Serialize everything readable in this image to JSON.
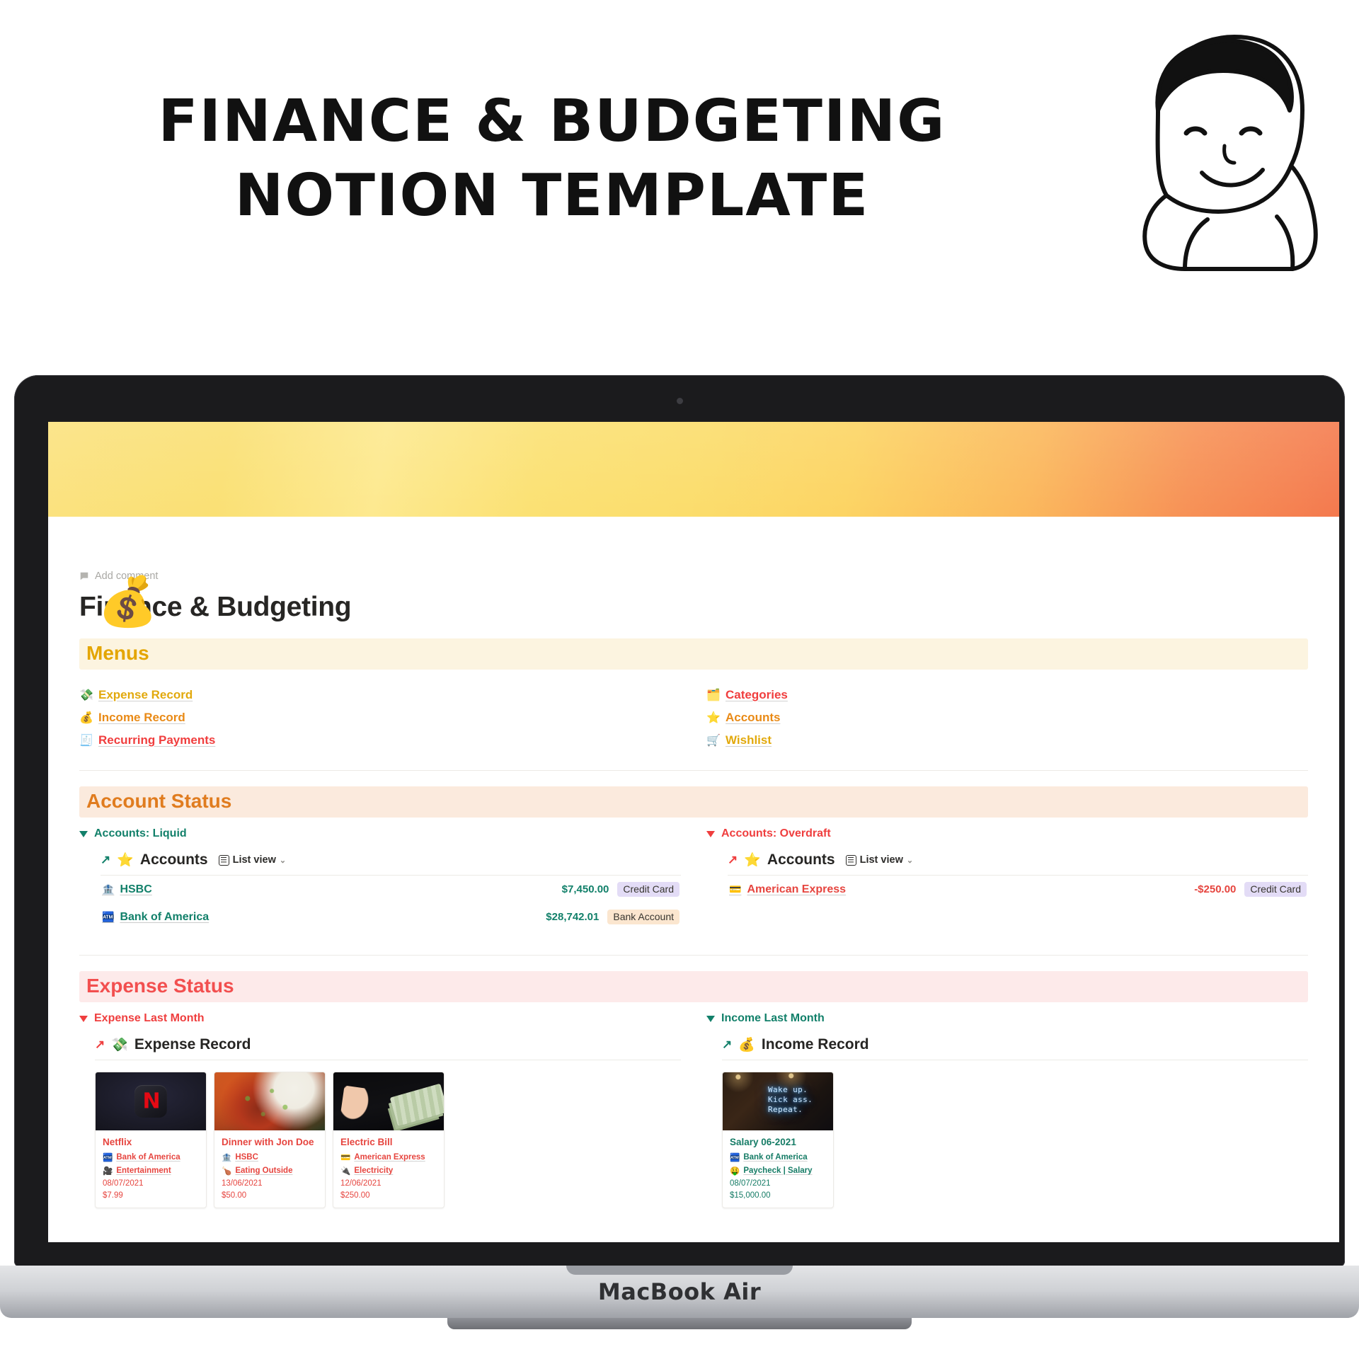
{
  "promo": {
    "title_line1": "Finance & Budgeting",
    "title_line2": "Notion Template"
  },
  "laptop": {
    "model_label": "MacBook Air"
  },
  "notion": {
    "page_emoji": "💰",
    "add_comment": "Add comment",
    "page_title": "Finance & Budgeting",
    "sections": {
      "menus": {
        "heading": "Menus",
        "left_items": [
          {
            "emoji": "💸",
            "label": "Expense Record",
            "color": "c-gold"
          },
          {
            "emoji": "💰",
            "label": "Income Record",
            "color": "c-orange"
          },
          {
            "emoji": "🧾",
            "label": "Recurring Payments",
            "color": "c-red"
          }
        ],
        "right_items": [
          {
            "emoji": "🗂️",
            "label": "Categories",
            "color": "c-red"
          },
          {
            "emoji": "⭐",
            "label": "Accounts",
            "color": "c-orange"
          },
          {
            "emoji": "🛒",
            "label": "Wishlist",
            "color": "c-gold"
          }
        ]
      },
      "account_status": {
        "heading": "Account Status",
        "liquid": {
          "toggle_label": "Accounts: Liquid",
          "db_emoji": "⭐",
          "db_name": "Accounts",
          "view_label": "List view",
          "rows": [
            {
              "emoji": "🏦",
              "name": "HSBC",
              "value": "$7,450.00",
              "tag": "Credit Card",
              "tag_class": "tag-credit"
            },
            {
              "emoji": "🏧",
              "name": "Bank of America",
              "value": "$28,742.01",
              "tag": "Bank Account",
              "tag_class": "tag-bank"
            }
          ]
        },
        "overdraft": {
          "toggle_label": "Accounts: Overdraft",
          "db_emoji": "⭐",
          "db_name": "Accounts",
          "view_label": "List view",
          "rows": [
            {
              "emoji": "💳",
              "name": "American Express",
              "value": "-$250.00",
              "tag": "Credit Card",
              "tag_class": "tag-credit"
            }
          ]
        }
      },
      "expense_status": {
        "heading": "Expense Status",
        "expense": {
          "toggle_label": "Expense Last Month",
          "db_emoji": "💸",
          "db_name": "Expense Record",
          "cards": [
            {
              "art": "img-netflix",
              "title": "Netflix",
              "account_emoji": "🏧",
              "account": "Bank of America",
              "category_emoji": "🎥",
              "category": "Entertainment",
              "date": "08/07/2021",
              "amount": "$7.99"
            },
            {
              "art": "img-food",
              "title": "Dinner with Jon Doe",
              "account_emoji": "🏦",
              "account": "HSBC",
              "category_emoji": "🍗",
              "category": "Eating Outside",
              "date": "13/06/2021",
              "amount": "$50.00"
            },
            {
              "art": "img-cash",
              "title": "Electric Bill",
              "account_emoji": "💳",
              "account": "American Express",
              "category_emoji": "🔌",
              "category": "Electricity",
              "date": "12/06/2021",
              "amount": "$250.00"
            }
          ]
        },
        "income": {
          "toggle_label": "Income Last Month",
          "db_emoji": "💰",
          "db_name": "Income Record",
          "neon_sign": "Wake up.\nKick ass.\nRepeat.",
          "cards": [
            {
              "art": "img-neon",
              "title": "Salary 06-2021",
              "account_emoji": "🏧",
              "account": "Bank of America",
              "category_emoji": "🤑",
              "category": "Paycheck | Salary",
              "date": "08/07/2021",
              "amount": "$15,000.00"
            }
          ]
        }
      }
    }
  },
  "colors": {
    "gold": "#e2a90d",
    "orange": "#e98a16",
    "red": "#f03e3e",
    "teal": "#12806a",
    "rose": "#ef3e3e"
  }
}
